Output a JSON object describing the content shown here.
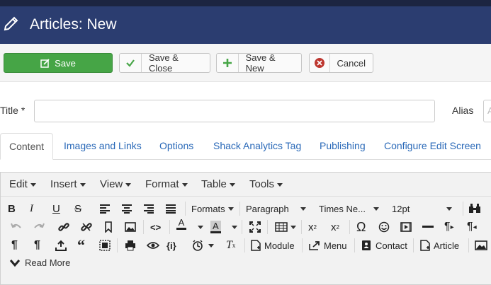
{
  "header": {
    "title": "Articles: New"
  },
  "toolbar": {
    "save_label": "Save",
    "save_close_label": "Save & Close",
    "save_new_label": "Save & New",
    "cancel_label": "Cancel"
  },
  "form": {
    "title_label": "Title *",
    "alias_label": "Alias",
    "alias_placeholder": "A",
    "title_value": ""
  },
  "tabs": [
    "Content",
    "Images and Links",
    "Options",
    "Shack Analytics Tag",
    "Publishing",
    "Configure Edit Screen"
  ],
  "editor": {
    "menus": [
      "Edit",
      "Insert",
      "View",
      "Format",
      "Table",
      "Tools"
    ],
    "formats_label": "Formats",
    "block_format": "Paragraph",
    "font_family": "Times Ne...",
    "font_size": "12pt",
    "buttons": {
      "module": "Module",
      "menu": "Menu",
      "contact": "Contact",
      "article": "Article",
      "read_more": "Read More"
    }
  },
  "colors": {
    "header_bg": "#2b3d70",
    "save_bg": "#46a546",
    "link": "#2a69b8"
  }
}
